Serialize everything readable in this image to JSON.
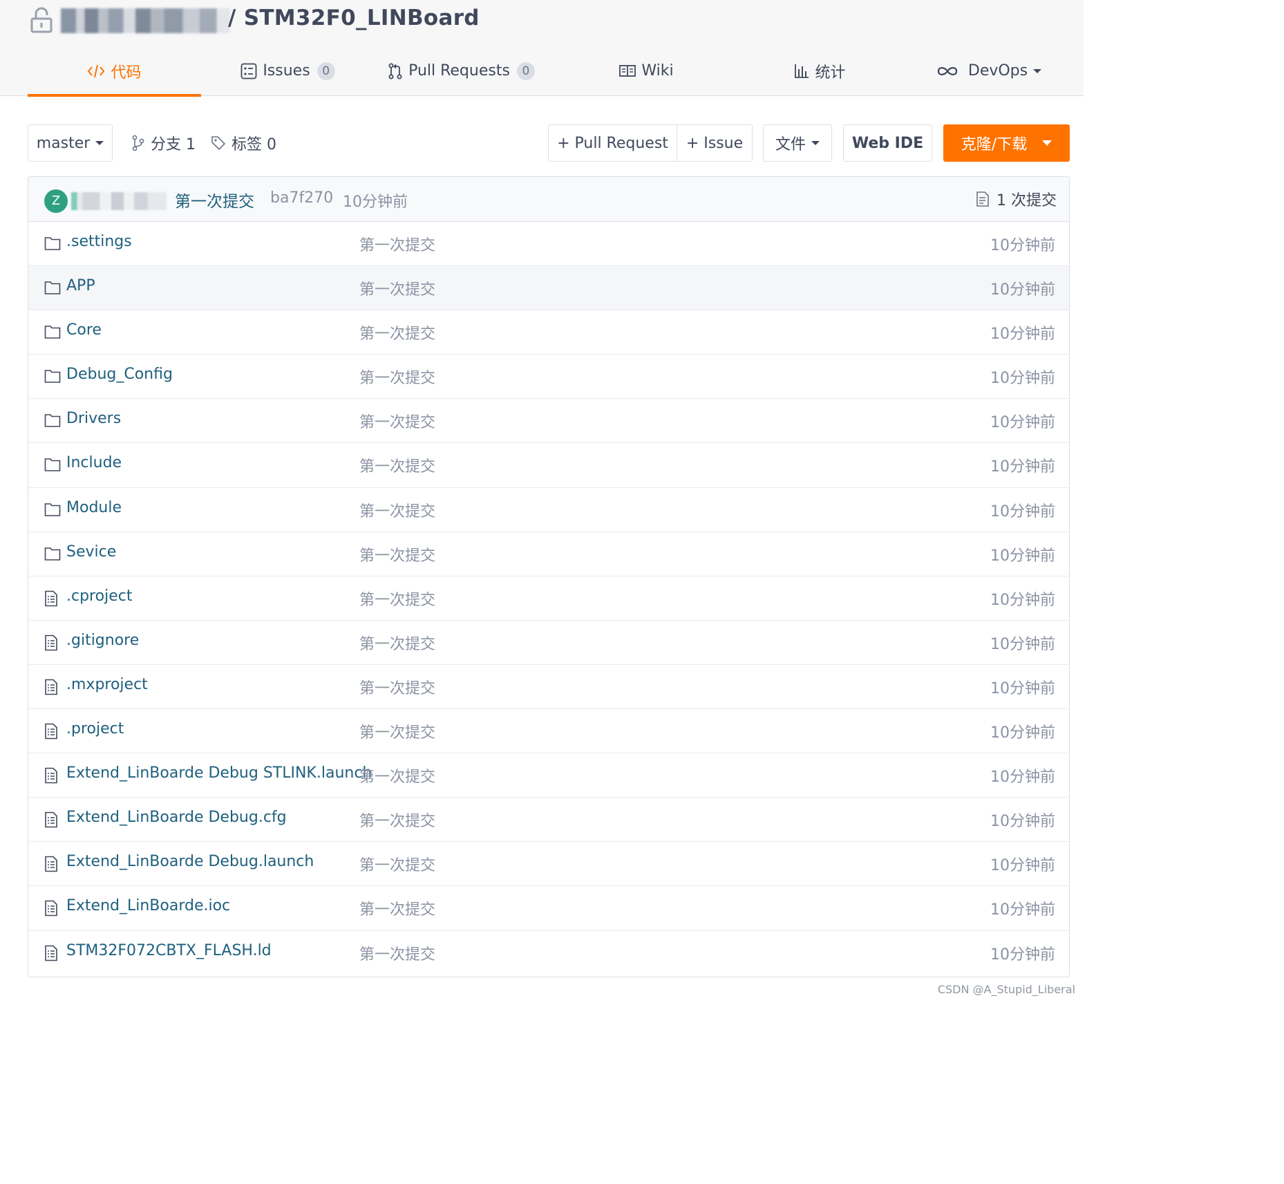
{
  "header": {
    "repo_name": "/ STM32F0_LINBoard"
  },
  "tabs": [
    {
      "label": "代码",
      "icon": "code-icon",
      "active": true
    },
    {
      "label": "Issues",
      "icon": "issues-icon",
      "count": "0"
    },
    {
      "label": "Pull Requests",
      "icon": "pull-request-icon",
      "count": "0"
    },
    {
      "label": "Wiki",
      "icon": "wiki-icon"
    },
    {
      "label": "统计",
      "icon": "stats-icon"
    },
    {
      "label": "DevOps",
      "icon": "infinity-icon"
    }
  ],
  "toolbar": {
    "branch": "master",
    "branches": "分支 1",
    "tags": "标签 0",
    "new_pr": "+ Pull Request",
    "new_issue": "+ Issue",
    "file_menu": "文件",
    "web_ide": "Web IDE",
    "clone": "克隆/下载"
  },
  "commit": {
    "avatar_letter": "Z",
    "message": "第一次提交",
    "hash": "ba7f270",
    "time": "10分钟前",
    "count": "1 次提交"
  },
  "files": [
    {
      "type": "folder",
      "name": ".settings",
      "commit": "第一次提交",
      "time": "10分钟前"
    },
    {
      "type": "folder",
      "name": "APP",
      "commit": "第一次提交",
      "time": "10分钟前"
    },
    {
      "type": "folder",
      "name": "Core",
      "commit": "第一次提交",
      "time": "10分钟前"
    },
    {
      "type": "folder",
      "name": "Debug_Config",
      "commit": "第一次提交",
      "time": "10分钟前"
    },
    {
      "type": "folder",
      "name": "Drivers",
      "commit": "第一次提交",
      "time": "10分钟前"
    },
    {
      "type": "folder",
      "name": "Include",
      "commit": "第一次提交",
      "time": "10分钟前"
    },
    {
      "type": "folder",
      "name": "Module",
      "commit": "第一次提交",
      "time": "10分钟前"
    },
    {
      "type": "folder",
      "name": "Sevice",
      "commit": "第一次提交",
      "time": "10分钟前"
    },
    {
      "type": "file",
      "name": ".cproject",
      "commit": "第一次提交",
      "time": "10分钟前"
    },
    {
      "type": "file",
      "name": ".gitignore",
      "commit": "第一次提交",
      "time": "10分钟前"
    },
    {
      "type": "file",
      "name": ".mxproject",
      "commit": "第一次提交",
      "time": "10分钟前"
    },
    {
      "type": "file",
      "name": ".project",
      "commit": "第一次提交",
      "time": "10分钟前"
    },
    {
      "type": "file",
      "name": "Extend_LinBoarde Debug STLINK.launch",
      "commit": "第一次提交",
      "time": "10分钟前"
    },
    {
      "type": "file",
      "name": "Extend_LinBoarde Debug.cfg",
      "commit": "第一次提交",
      "time": "10分钟前"
    },
    {
      "type": "file",
      "name": "Extend_LinBoarde Debug.launch",
      "commit": "第一次提交",
      "time": "10分钟前"
    },
    {
      "type": "file",
      "name": "Extend_LinBoarde.ioc",
      "commit": "第一次提交",
      "time": "10分钟前"
    },
    {
      "type": "file",
      "name": "STM32F072CBTX_FLASH.ld",
      "commit": "第一次提交",
      "time": "10分钟前"
    }
  ],
  "watermark": "CSDN @A_Stupid_Liberal",
  "colors": {
    "accent": "#fe7300",
    "link": "#1e5f7e",
    "muted": "#8c92a4",
    "avatar": "#2ea082"
  }
}
